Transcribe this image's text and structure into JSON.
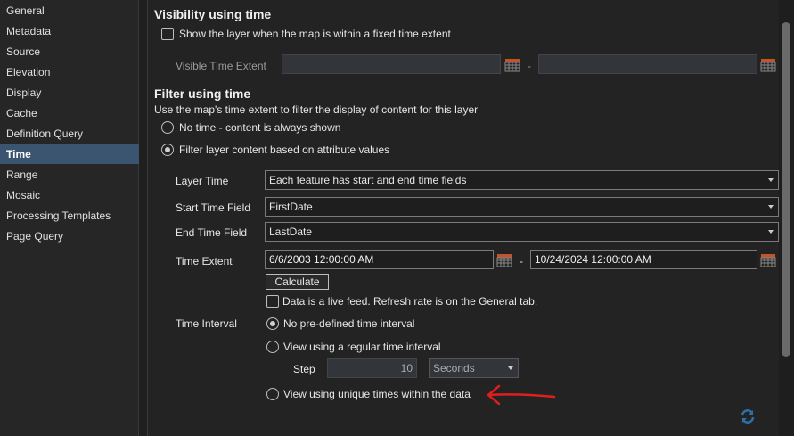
{
  "sidebar": {
    "items": [
      "General",
      "Metadata",
      "Source",
      "Elevation",
      "Display",
      "Cache",
      "Definition Query",
      "Time",
      "Range",
      "Mosaic",
      "Processing Templates",
      "Page Query"
    ],
    "selected": "Time"
  },
  "visibility": {
    "heading": "Visibility using time",
    "checkbox_label": "Show the layer when the map is within a fixed time extent",
    "checked": false,
    "extent_label": "Visible Time Extent",
    "dash": "-"
  },
  "filter": {
    "heading": "Filter using time",
    "description": "Use the map's time extent to filter the display of content for this layer",
    "opt_none": "No time - content is always shown",
    "opt_attr": "Filter layer content based on attribute values",
    "selected": "attr"
  },
  "form": {
    "layer_time_label": "Layer Time",
    "layer_time_value": "Each feature has start and end time fields",
    "start_label": "Start Time Field",
    "start_value": "FirstDate",
    "end_label": "End Time Field",
    "end_value": "LastDate",
    "extent_label": "Time Extent",
    "extent_start": "6/6/2003 12:00:00 AM",
    "extent_end": "10/24/2024 12:00:00 AM",
    "dash": "-",
    "calculate": "Calculate",
    "live_feed": "Data is a live feed. Refresh rate is on the General tab.",
    "interval_label": "Time Interval",
    "interval_none": "No pre-defined time interval",
    "interval_regular": "View using a regular time interval",
    "step_label": "Step",
    "step_value": "10",
    "step_unit": "Seconds",
    "interval_unique": "View using unique times within the data"
  },
  "colors": {
    "accent": "#3b5570",
    "annotation": "#e01e1e",
    "refresh": "#2f6fa8"
  }
}
